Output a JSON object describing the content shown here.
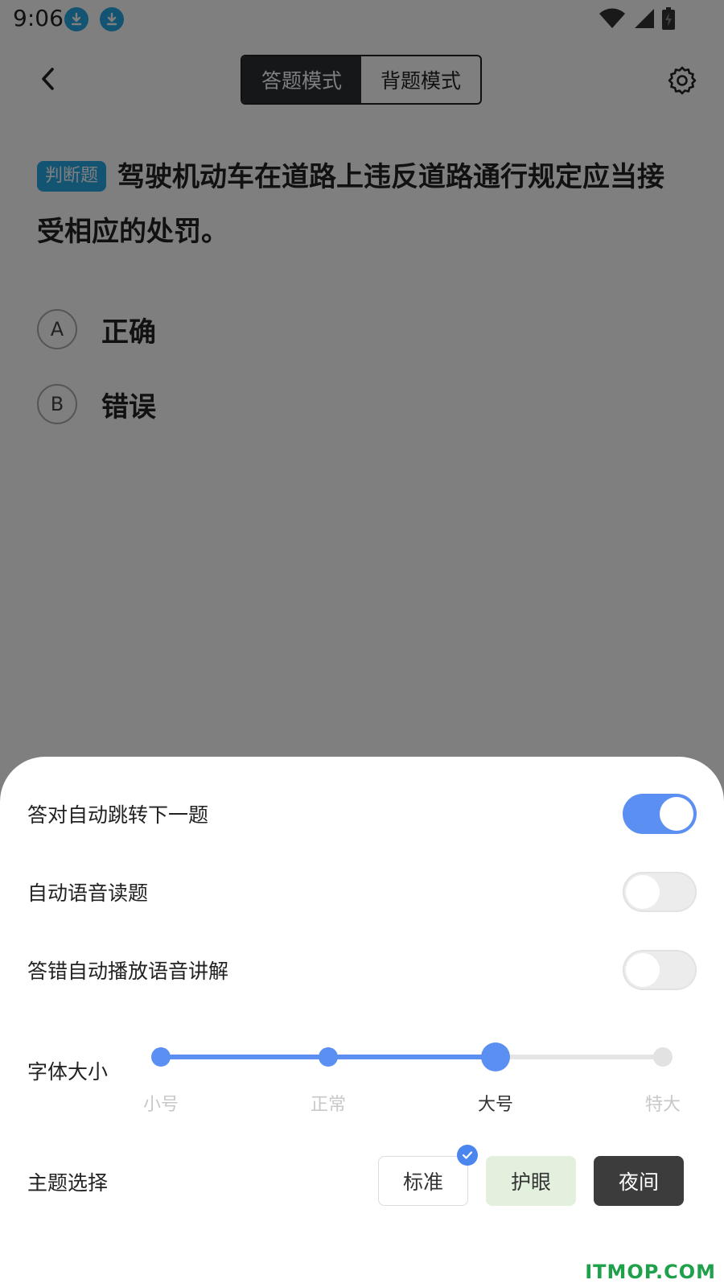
{
  "status_bar": {
    "time": "9:06",
    "icons": [
      "download-icon",
      "download-icon",
      "wifi-icon",
      "signal-icon",
      "battery-charging-icon"
    ]
  },
  "top_bar": {
    "back_icon": "chevron-left-icon",
    "tabs": [
      {
        "label": "答题模式",
        "active": true
      },
      {
        "label": "背题模式",
        "active": false
      }
    ],
    "settings_icon": "gear-icon"
  },
  "question": {
    "type_badge": "判断题",
    "text": "驾驶机动车在道路上违反道路通行规定应当接受相应的处罚。",
    "options": [
      {
        "letter": "A",
        "text": "正确"
      },
      {
        "letter": "B",
        "text": "错误"
      }
    ]
  },
  "settings": {
    "toggles": [
      {
        "label": "答对自动跳转下一题",
        "on": true
      },
      {
        "label": "自动语音读题",
        "on": false
      },
      {
        "label": "答错自动播放语音讲解",
        "on": false
      }
    ],
    "font_size": {
      "label": "字体大小",
      "options": [
        "小号",
        "正常",
        "大号",
        "特大"
      ],
      "selected_index": 2
    },
    "theme": {
      "label": "主题选择",
      "options": [
        "标准",
        "护眼",
        "夜间"
      ],
      "selected": "标准"
    }
  },
  "colors": {
    "accent": "#5b8ff2",
    "badge": "#29a8e6",
    "check": "#4a86ee"
  },
  "watermark": "ITMOP.COM"
}
